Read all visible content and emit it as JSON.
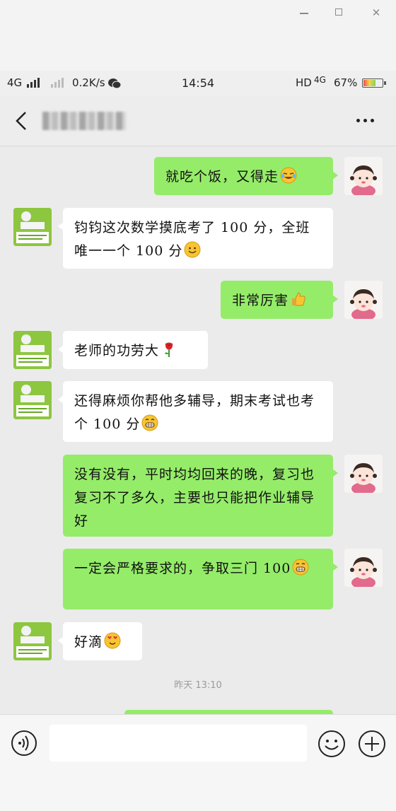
{
  "window": {
    "minimize_label": "",
    "maximize_label": "",
    "close_label": "✕"
  },
  "status_bar": {
    "network": "4G",
    "speed": "0.2K/s",
    "time": "14:54",
    "hd": "HD",
    "network2": "4G",
    "battery_percent": "67%",
    "battery_level": 0.67
  },
  "nav": {
    "back_icon": "chevron-left-icon",
    "more_icon": "more-icon"
  },
  "messages": [
    {
      "sender": "self",
      "text": "就吃个饭，又得走",
      "emoji": "laugh-cry-emoji"
    },
    {
      "sender": "other",
      "text": "钧钧这次数学摸底考了 100 分，全班唯一一个 100 分",
      "emoji": "smile-emoji"
    },
    {
      "sender": "self",
      "text": "非常厉害",
      "emoji": "thumbs-up-emoji"
    },
    {
      "sender": "other",
      "text": "老师的功劳大",
      "emoji": "rose-emoji"
    },
    {
      "sender": "other",
      "text": "还得麻烦你帮他多辅导，期末考试也考个 100 分",
      "emoji": "grin-emoji"
    },
    {
      "sender": "self",
      "text": "没有没有，平时均均回来的晚，复习也复习不了多久，主要也只能把作业辅导好",
      "emoji": ""
    },
    {
      "sender": "self",
      "text": "一定会严格要求的，争取三门 100",
      "emoji": "grin-emoji"
    },
    {
      "sender": "other",
      "text": "好滴",
      "emoji": "heart-eyes-emoji"
    }
  ],
  "timestamp": "昨天 13:10",
  "input": {
    "placeholder": "",
    "value": ""
  },
  "colors": {
    "self_bubble": "#95ec69",
    "other_bubble": "#ffffff",
    "background": "#ebebeb"
  }
}
